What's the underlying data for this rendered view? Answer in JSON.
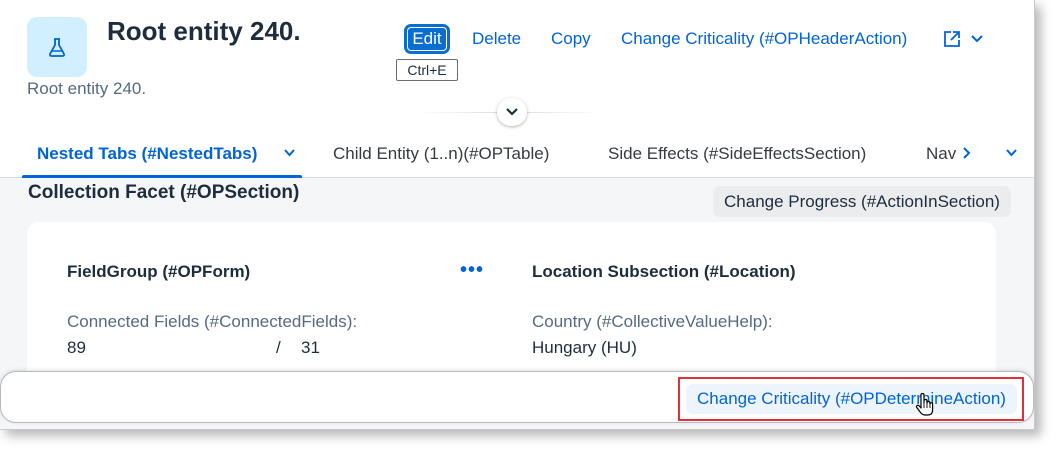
{
  "header": {
    "title": "Root entity 240.",
    "subtitle": "Root entity 240.",
    "avatar_icon": "flask-icon",
    "actions": {
      "edit": "Edit",
      "edit_shortcut": "Ctrl+E",
      "delete": "Delete",
      "copy": "Copy",
      "change_criticality": "Change Criticality (#OPHeaderAction)"
    },
    "share_icon": "share-icon"
  },
  "tabs": [
    {
      "label": "Nested Tabs (#NestedTabs)",
      "selected": true
    },
    {
      "label": "Child Entity (1..n)(#OPTable)",
      "selected": false
    },
    {
      "label": "Side Effects (#SideEffectsSection)",
      "selected": false
    },
    {
      "label": "Nav",
      "selected": false
    }
  ],
  "section": {
    "title": "Collection Facet (#OPSection)",
    "action": "Change Progress (#ActionInSection)"
  },
  "card": {
    "left": {
      "title": "FieldGroup (#OPForm)",
      "field_label": "Connected Fields (#ConnectedFields):",
      "value_a": "89",
      "separator": "/",
      "value_b": "31"
    },
    "right": {
      "title": "Location Subsection (#Location)",
      "field_label": "Country (#CollectiveValueHelp):",
      "value": "Hungary (HU)"
    }
  },
  "footer": {
    "action": "Change Criticality (#OPDetermineAction)"
  },
  "colors": {
    "brand": "#0064d9",
    "highlight": "#e0303a"
  }
}
